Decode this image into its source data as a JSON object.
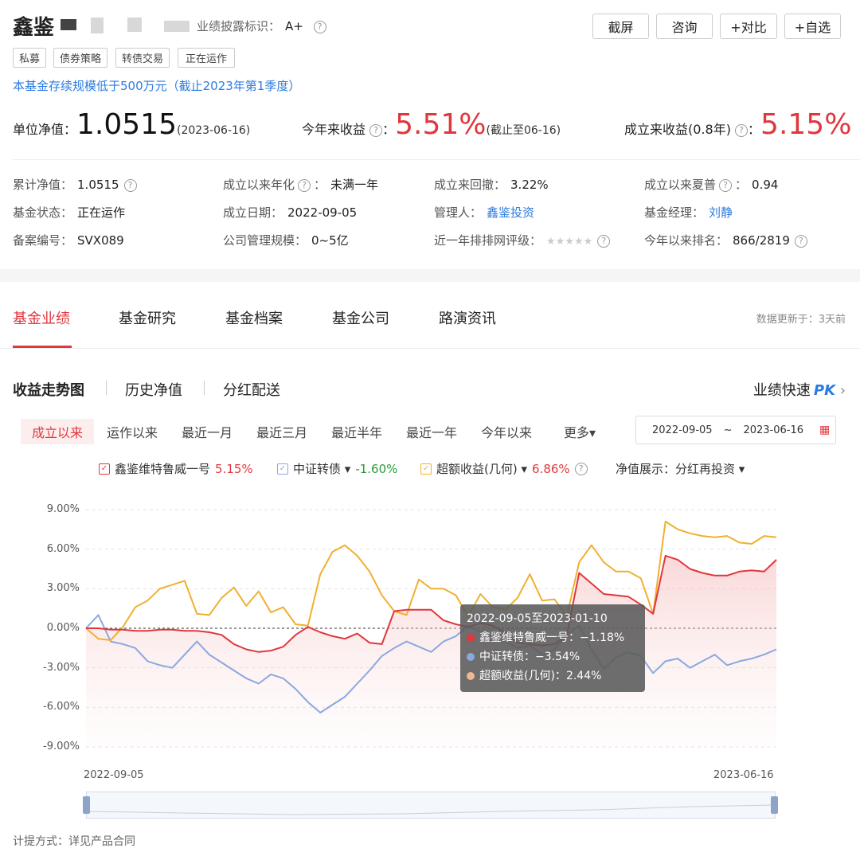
{
  "header": {
    "fund_name": "鑫鉴",
    "disclosure_label": "业绩披露标识：",
    "disclosure_value": "A+",
    "buttons": [
      "截屏",
      "咨询",
      "+对比",
      "+自选"
    ],
    "tags": [
      "私募",
      "债券策略",
      "转债交易",
      "正在运作"
    ],
    "notice": "本基金存续规模低于500万元（截止2023年第1季度）"
  },
  "metrics": {
    "nav_label": "单位净值：",
    "nav_value": "1.0515",
    "nav_date": "(2023-06-16)",
    "ytd_label": "今年来收益",
    "ytd_value": "5.51%",
    "ytd_note": "(截止至06-16)",
    "since_label": "成立来收益(0.8年)",
    "since_value": "5.15%"
  },
  "details": [
    {
      "label": "累计净值：",
      "value": "1.0515",
      "help": true
    },
    {
      "label": "成立以来年化",
      "value": "未满一年",
      "help": true
    },
    {
      "label": "成立来回撤：",
      "value": "3.22%"
    },
    {
      "label": "成立以来夏普",
      "value": "0.94",
      "help": true
    },
    {
      "label": "基金状态：",
      "value": "正在运作"
    },
    {
      "label": "成立日期：",
      "value": "2022-09-05"
    },
    {
      "label": "管理人：",
      "value": "鑫鉴投资",
      "link": true
    },
    {
      "label": "基金经理：",
      "value": "刘静",
      "link": true
    },
    {
      "label": "备案编号：",
      "value": "SVX089"
    },
    {
      "label": "公司管理规模：",
      "value": "0~5亿"
    },
    {
      "label": "近一年排排网评级：",
      "value": "★★★★★",
      "help": true
    },
    {
      "label": "今年以来排名：",
      "value": "866/2819",
      "help": true
    }
  ],
  "tabs": [
    "基金业绩",
    "基金研究",
    "基金档案",
    "基金公司",
    "路演资讯"
  ],
  "update_text": "数据更新于：3天前",
  "subtabs": [
    "收益走势图",
    "历史净值",
    "分红配送"
  ],
  "pk_label": "业绩快速",
  "pk_badge": "PK",
  "ranges": [
    "成立以来",
    "运作以来",
    "最近一月",
    "最近三月",
    "最近半年",
    "最近一年",
    "今年以来",
    "更多▾"
  ],
  "date_range": {
    "start": "2022-09-05",
    "sep": "~",
    "end": "2023-06-16"
  },
  "legend": [
    {
      "name": "鑫鉴维特鲁威一号",
      "value": "5.15%",
      "color": "#e0373d",
      "value_color": "#e0373d"
    },
    {
      "name": "中证转债 ▾",
      "value": "-1.60%",
      "color": "#8aa8e0",
      "value_color": "#2a9a3a"
    },
    {
      "name": "超额收益(几何) ▾",
      "value": "6.86%",
      "color": "#f0b030",
      "value_color": "#e0373d"
    }
  ],
  "nav_display": "净值展示：分红再投资 ▾",
  "tooltip": {
    "title": "2022-09-05至2023-01-10",
    "rows": [
      {
        "label": "鑫鉴维特鲁威一号：",
        "value": "−1.18%",
        "color": "#e0373d"
      },
      {
        "label": "中证转债：",
        "value": "−3.54%",
        "color": "#8aa8e0"
      },
      {
        "label": "超额收益(几何)：",
        "value": "2.44%",
        "color": "#f0b890"
      }
    ]
  },
  "footer": "计提方式：详见产品合同",
  "chart_data": {
    "type": "line",
    "x_start": "2022-09-05",
    "x_end": "2023-06-16",
    "xticks": [
      "2022-09-05",
      "2023-06-16"
    ],
    "yticks": [
      "9.00%",
      "6.00%",
      "3.00%",
      "0.00%",
      "-3.00%",
      "-6.00%",
      "-9.00%"
    ],
    "ylim": [
      -9,
      9
    ],
    "series": [
      {
        "name": "鑫鉴维特鲁威一号",
        "color": "#e0373d",
        "values": [
          0,
          0,
          -0.1,
          -0.1,
          -0.2,
          -0.2,
          -0.1,
          -0.1,
          -0.2,
          -0.2,
          -0.3,
          -0.5,
          -1.2,
          -1.6,
          -1.8,
          -1.7,
          -1.4,
          -0.5,
          0.1,
          -0.3,
          -0.6,
          -0.8,
          -0.4,
          -1.1,
          -1.2,
          1.3,
          1.4,
          1.4,
          1.4,
          0.6,
          0.3,
          0.1,
          0.4,
          0.2,
          -0.3,
          -1.1,
          -1.2,
          -1.3,
          -1.2,
          -0.5,
          4.2,
          3.4,
          2.6,
          2.5,
          2.4,
          1.8,
          1.1,
          5.5,
          5.2,
          4.5,
          4.2,
          4.0,
          4.0,
          4.3,
          4.4,
          4.3,
          5.2
        ]
      },
      {
        "name": "中证转债",
        "color": "#8aa8e0",
        "values": [
          0,
          1.0,
          -1.0,
          -1.2,
          -1.5,
          -2.5,
          -2.8,
          -3.0,
          -2.0,
          -1.0,
          -2.0,
          -2.6,
          -3.2,
          -3.8,
          -4.2,
          -3.5,
          -3.8,
          -4.6,
          -5.6,
          -6.4,
          -5.8,
          -5.2,
          -4.2,
          -3.2,
          -2.1,
          -1.5,
          -1.0,
          -1.4,
          -1.8,
          -1.0,
          -0.6,
          0.2,
          -0.3,
          -0.8,
          -1.0,
          -1.5,
          -1.3,
          -2.0,
          -1.6,
          -0.5,
          0.2,
          -1.6,
          -3.1,
          -2.2,
          -1.8,
          -2.1,
          -3.4,
          -2.5,
          -2.3,
          -3.0,
          -2.5,
          -2.0,
          -2.8,
          -2.5,
          -2.3,
          -2.0,
          -1.6
        ]
      },
      {
        "name": "超额收益(几何)",
        "color": "#f0b030",
        "values": [
          0,
          -0.8,
          -0.9,
          0.1,
          1.6,
          2.1,
          3.0,
          3.3,
          3.6,
          1.1,
          1.0,
          2.3,
          3.1,
          1.7,
          2.8,
          1.2,
          1.6,
          0.3,
          0.2,
          4.1,
          5.8,
          6.3,
          5.5,
          4.3,
          2.5,
          1.3,
          1.0,
          3.7,
          3.0,
          3.0,
          2.5,
          0.9,
          2.6,
          1.6,
          1.4,
          2.3,
          4.1,
          2.1,
          2.2,
          0.9,
          5.0,
          6.3,
          5.0,
          4.3,
          4.3,
          3.8,
          1.1,
          8.1,
          7.5,
          7.2,
          7.0,
          6.9,
          7.0,
          6.5,
          6.4,
          7.0,
          6.9
        ]
      }
    ]
  }
}
